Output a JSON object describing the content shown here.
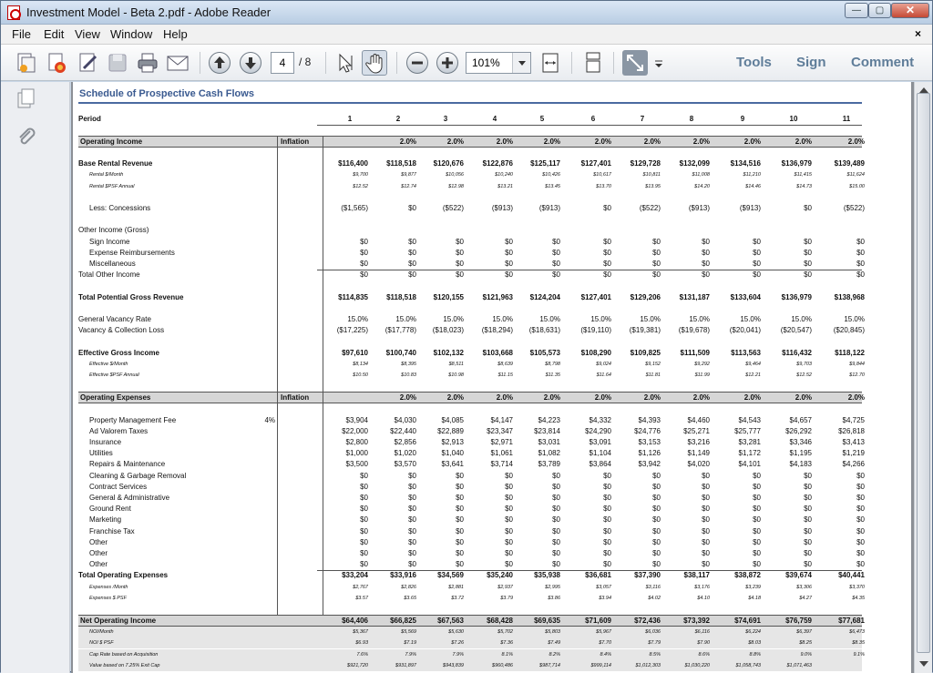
{
  "window": {
    "title": "Investment Model - Beta 2.pdf - Adobe Reader",
    "close_doc": "×"
  },
  "menu": [
    "File",
    "Edit",
    "View",
    "Window",
    "Help"
  ],
  "toolbar": {
    "page_current": "4",
    "page_total": "/ 8",
    "zoom": "101%",
    "right_links": [
      "Tools",
      "Sign",
      "Comment"
    ]
  },
  "sheet": {
    "title": "Schedule of Prospective Cash Flows",
    "period_label": "Period",
    "periods": [
      "1",
      "2",
      "3",
      "4",
      "5",
      "6",
      "7",
      "8",
      "9",
      "10",
      "11"
    ],
    "sections": [
      {
        "type": "band",
        "label": "Operating Income",
        "inflation_label": "Inflation",
        "vals": [
          "",
          "2.0%",
          "2.0%",
          "2.0%",
          "2.0%",
          "2.0%",
          "2.0%",
          "2.0%",
          "2.0%",
          "2.0%",
          "2.0%"
        ]
      },
      {
        "type": "gap"
      },
      {
        "type": "row",
        "style": "b",
        "label": "Base Rental Revenue",
        "vals": [
          "$116,400",
          "$118,518",
          "$120,676",
          "$122,876",
          "$125,117",
          "$127,401",
          "$129,728",
          "$132,099",
          "$134,516",
          "$136,979",
          "$139,489"
        ]
      },
      {
        "type": "row",
        "style": "sm",
        "label": "Rental $/Month",
        "vals": [
          "$9,700",
          "$9,877",
          "$10,056",
          "$10,240",
          "$10,426",
          "$10,617",
          "$10,811",
          "$11,008",
          "$11,210",
          "$11,415",
          "$11,624"
        ]
      },
      {
        "type": "row",
        "style": "sm",
        "label": "Rental $PSF Annual",
        "vals": [
          "$12.52",
          "$12.74",
          "$12.98",
          "$13.21",
          "$13.45",
          "$13.70",
          "$13.95",
          "$14.20",
          "$14.46",
          "$14.73",
          "$15.00"
        ]
      },
      {
        "type": "gap"
      },
      {
        "type": "row",
        "style": "ind",
        "label": "Less: Concessions",
        "vals": [
          "($1,565)",
          "$0",
          "($522)",
          "($913)",
          "($913)",
          "$0",
          "($522)",
          "($913)",
          "($913)",
          "$0",
          "($522)"
        ]
      },
      {
        "type": "gap"
      },
      {
        "type": "row",
        "label": "Other Income (Gross)",
        "vals": [
          "",
          "",
          "",
          "",
          "",
          "",
          "",
          "",
          "",
          "",
          ""
        ]
      },
      {
        "type": "row",
        "style": "ind",
        "label": "Sign Income",
        "vals": [
          "$0",
          "$0",
          "$0",
          "$0",
          "$0",
          "$0",
          "$0",
          "$0",
          "$0",
          "$0",
          "$0"
        ]
      },
      {
        "type": "row",
        "style": "ind",
        "label": "Expense Reimbursements",
        "vals": [
          "$0",
          "$0",
          "$0",
          "$0",
          "$0",
          "$0",
          "$0",
          "$0",
          "$0",
          "$0",
          "$0"
        ]
      },
      {
        "type": "row",
        "style": "ind",
        "label": "Miscellaneous",
        "vals": [
          "$0",
          "$0",
          "$0",
          "$0",
          "$0",
          "$0",
          "$0",
          "$0",
          "$0",
          "$0",
          "$0"
        ]
      },
      {
        "type": "row",
        "style": "top",
        "label": "Total Other Income",
        "vals": [
          "$0",
          "$0",
          "$0",
          "$0",
          "$0",
          "$0",
          "$0",
          "$0",
          "$0",
          "$0",
          "$0"
        ]
      },
      {
        "type": "gap"
      },
      {
        "type": "row",
        "style": "b",
        "label": "Total Potential Gross Revenue",
        "vals": [
          "$114,835",
          "$118,518",
          "$120,155",
          "$121,963",
          "$124,204",
          "$127,401",
          "$129,206",
          "$131,187",
          "$133,604",
          "$136,979",
          "$138,968"
        ]
      },
      {
        "type": "gap"
      },
      {
        "type": "row",
        "label": "General Vacancy Rate",
        "vals": [
          "15.0%",
          "15.0%",
          "15.0%",
          "15.0%",
          "15.0%",
          "15.0%",
          "15.0%",
          "15.0%",
          "15.0%",
          "15.0%",
          "15.0%"
        ]
      },
      {
        "type": "row",
        "label": "Vacancy & Collection Loss",
        "vals": [
          "($17,225)",
          "($17,778)",
          "($18,023)",
          "($18,294)",
          "($18,631)",
          "($19,110)",
          "($19,381)",
          "($19,678)",
          "($20,041)",
          "($20,547)",
          "($20,845)"
        ]
      },
      {
        "type": "gap"
      },
      {
        "type": "row",
        "style": "b",
        "label": "Effective Gross Income",
        "vals": [
          "$97,610",
          "$100,740",
          "$102,132",
          "$103,668",
          "$105,573",
          "$108,290",
          "$109,825",
          "$111,509",
          "$113,563",
          "$116,432",
          "$118,122"
        ]
      },
      {
        "type": "row",
        "style": "sm",
        "label": "Effective $/Month",
        "vals": [
          "$8,134",
          "$8,395",
          "$8,511",
          "$8,639",
          "$8,798",
          "$9,024",
          "$9,152",
          "$9,292",
          "$9,464",
          "$9,703",
          "$9,844"
        ]
      },
      {
        "type": "row",
        "style": "sm",
        "label": "Effective $PSF Annual",
        "vals": [
          "$10.50",
          "$10.83",
          "$10.98",
          "$11.15",
          "$11.35",
          "$11.64",
          "$11.81",
          "$11.99",
          "$12.21",
          "$12.52",
          "$12.70"
        ]
      },
      {
        "type": "gap"
      },
      {
        "type": "band",
        "label": "Operating Expenses",
        "inflation_label": "Inflation",
        "vals": [
          "",
          "2.0%",
          "2.0%",
          "2.0%",
          "2.0%",
          "2.0%",
          "2.0%",
          "2.0%",
          "2.0%",
          "2.0%",
          "2.0%"
        ]
      },
      {
        "type": "gap"
      },
      {
        "type": "row",
        "style": "ind",
        "label": "Property Management Fee",
        "infl": "4%",
        "vals": [
          "$3,904",
          "$4,030",
          "$4,085",
          "$4,147",
          "$4,223",
          "$4,332",
          "$4,393",
          "$4,460",
          "$4,543",
          "$4,657",
          "$4,725"
        ]
      },
      {
        "type": "row",
        "style": "ind",
        "label": "Ad Valorem Taxes",
        "vals": [
          "$22,000",
          "$22,440",
          "$22,889",
          "$23,347",
          "$23,814",
          "$24,290",
          "$24,776",
          "$25,271",
          "$25,777",
          "$26,292",
          "$26,818"
        ]
      },
      {
        "type": "row",
        "style": "ind",
        "label": "Insurance",
        "vals": [
          "$2,800",
          "$2,856",
          "$2,913",
          "$2,971",
          "$3,031",
          "$3,091",
          "$3,153",
          "$3,216",
          "$3,281",
          "$3,346",
          "$3,413"
        ]
      },
      {
        "type": "row",
        "style": "ind",
        "label": "Utilities",
        "vals": [
          "$1,000",
          "$1,020",
          "$1,040",
          "$1,061",
          "$1,082",
          "$1,104",
          "$1,126",
          "$1,149",
          "$1,172",
          "$1,195",
          "$1,219"
        ]
      },
      {
        "type": "row",
        "style": "ind",
        "label": "Repairs & Maintenance",
        "vals": [
          "$3,500",
          "$3,570",
          "$3,641",
          "$3,714",
          "$3,789",
          "$3,864",
          "$3,942",
          "$4,020",
          "$4,101",
          "$4,183",
          "$4,266"
        ]
      },
      {
        "type": "row",
        "style": "ind",
        "label": "Cleaning & Garbage Removal",
        "vals": [
          "$0",
          "$0",
          "$0",
          "$0",
          "$0",
          "$0",
          "$0",
          "$0",
          "$0",
          "$0",
          "$0"
        ]
      },
      {
        "type": "row",
        "style": "ind",
        "label": "Contract Services",
        "vals": [
          "$0",
          "$0",
          "$0",
          "$0",
          "$0",
          "$0",
          "$0",
          "$0",
          "$0",
          "$0",
          "$0"
        ]
      },
      {
        "type": "row",
        "style": "ind",
        "label": "General & Administrative",
        "vals": [
          "$0",
          "$0",
          "$0",
          "$0",
          "$0",
          "$0",
          "$0",
          "$0",
          "$0",
          "$0",
          "$0"
        ]
      },
      {
        "type": "row",
        "style": "ind",
        "label": "Ground Rent",
        "vals": [
          "$0",
          "$0",
          "$0",
          "$0",
          "$0",
          "$0",
          "$0",
          "$0",
          "$0",
          "$0",
          "$0"
        ]
      },
      {
        "type": "row",
        "style": "ind",
        "label": "Marketing",
        "vals": [
          "$0",
          "$0",
          "$0",
          "$0",
          "$0",
          "$0",
          "$0",
          "$0",
          "$0",
          "$0",
          "$0"
        ]
      },
      {
        "type": "row",
        "style": "ind",
        "label": "Franchise Tax",
        "vals": [
          "$0",
          "$0",
          "$0",
          "$0",
          "$0",
          "$0",
          "$0",
          "$0",
          "$0",
          "$0",
          "$0"
        ]
      },
      {
        "type": "row",
        "style": "ind",
        "label": "Other",
        "vals": [
          "$0",
          "$0",
          "$0",
          "$0",
          "$0",
          "$0",
          "$0",
          "$0",
          "$0",
          "$0",
          "$0"
        ]
      },
      {
        "type": "row",
        "style": "ind",
        "label": "Other",
        "vals": [
          "$0",
          "$0",
          "$0",
          "$0",
          "$0",
          "$0",
          "$0",
          "$0",
          "$0",
          "$0",
          "$0"
        ]
      },
      {
        "type": "row",
        "style": "ind",
        "label": "Other",
        "vals": [
          "$0",
          "$0",
          "$0",
          "$0",
          "$0",
          "$0",
          "$0",
          "$0",
          "$0",
          "$0",
          "$0"
        ]
      },
      {
        "type": "row",
        "style": "b top",
        "label": "Total Operating Expenses",
        "vals": [
          "$33,204",
          "$33,916",
          "$34,569",
          "$35,240",
          "$35,938",
          "$36,681",
          "$37,390",
          "$38,117",
          "$38,872",
          "$39,674",
          "$40,441"
        ]
      },
      {
        "type": "row",
        "style": "sm",
        "label": "Expenses /Month",
        "vals": [
          "$2,767",
          "$2,826",
          "$2,881",
          "$2,937",
          "$2,995",
          "$3,057",
          "$3,116",
          "$3,176",
          "$3,239",
          "$3,306",
          "$3,370"
        ]
      },
      {
        "type": "row",
        "style": "sm",
        "label": "Expenses $ PSF",
        "vals": [
          "$3.57",
          "$3.65",
          "$3.72",
          "$3.79",
          "$3.86",
          "$3.94",
          "$4.02",
          "$4.10",
          "$4.18",
          "$4.27",
          "$4.35"
        ]
      },
      {
        "type": "gap"
      },
      {
        "type": "netband",
        "label": "Net Operating Income",
        "vals": [
          "$64,406",
          "$66,825",
          "$67,563",
          "$68,428",
          "$69,635",
          "$71,609",
          "$72,436",
          "$73,392",
          "$74,691",
          "$76,759",
          "$77,681"
        ]
      },
      {
        "type": "row",
        "style": "sm shade",
        "label": "NOI/Month",
        "vals": [
          "$5,367",
          "$5,569",
          "$5,630",
          "$5,702",
          "$5,803",
          "$5,967",
          "$6,036",
          "$6,116",
          "$6,224",
          "$6,397",
          "$6,473"
        ]
      },
      {
        "type": "row",
        "style": "sm shade",
        "label": "NOI $ PSF",
        "vals": [
          "$6.93",
          "$7.19",
          "$7.26",
          "$7.36",
          "$7.49",
          "$7.70",
          "$7.79",
          "$7.90",
          "$8.03",
          "$8.25",
          "$8.35"
        ]
      },
      {
        "type": "row",
        "style": "sm shade",
        "label": "Cap Rate based on Acquisition",
        "vals": [
          "7.6%",
          "7.9%",
          "7.9%",
          "8.1%",
          "8.2%",
          "8.4%",
          "8.5%",
          "8.6%",
          "8.8%",
          "9.0%",
          "9.1%"
        ]
      },
      {
        "type": "row",
        "style": "sm shade",
        "label": "Value based on 7.25% Exit Cap",
        "vals": [
          "$921,720",
          "$931,897",
          "$943,839",
          "$960,486",
          "$987,714",
          "$999,114",
          "$1,012,303",
          "$1,030,220",
          "$1,058,743",
          "$1,071,463",
          ""
        ]
      }
    ]
  }
}
